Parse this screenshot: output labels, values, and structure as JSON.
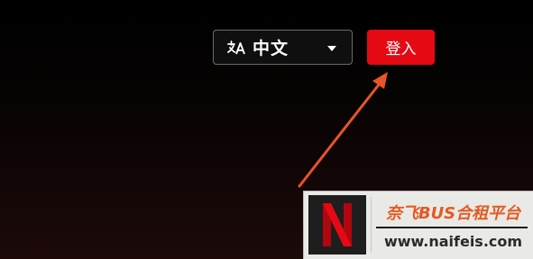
{
  "header": {
    "language_selector": {
      "icon": "translate-icon",
      "selected": "中文"
    },
    "login_button": {
      "label": "登入"
    }
  },
  "annotation": {
    "arrow_color": "#e8532a"
  },
  "watermark": {
    "logo_letter": "N",
    "title": "奈飞BUS合租平台",
    "url": "www.naifeis.com"
  },
  "colors": {
    "accent": "#e50914",
    "watermark_title": "#e45a22"
  }
}
